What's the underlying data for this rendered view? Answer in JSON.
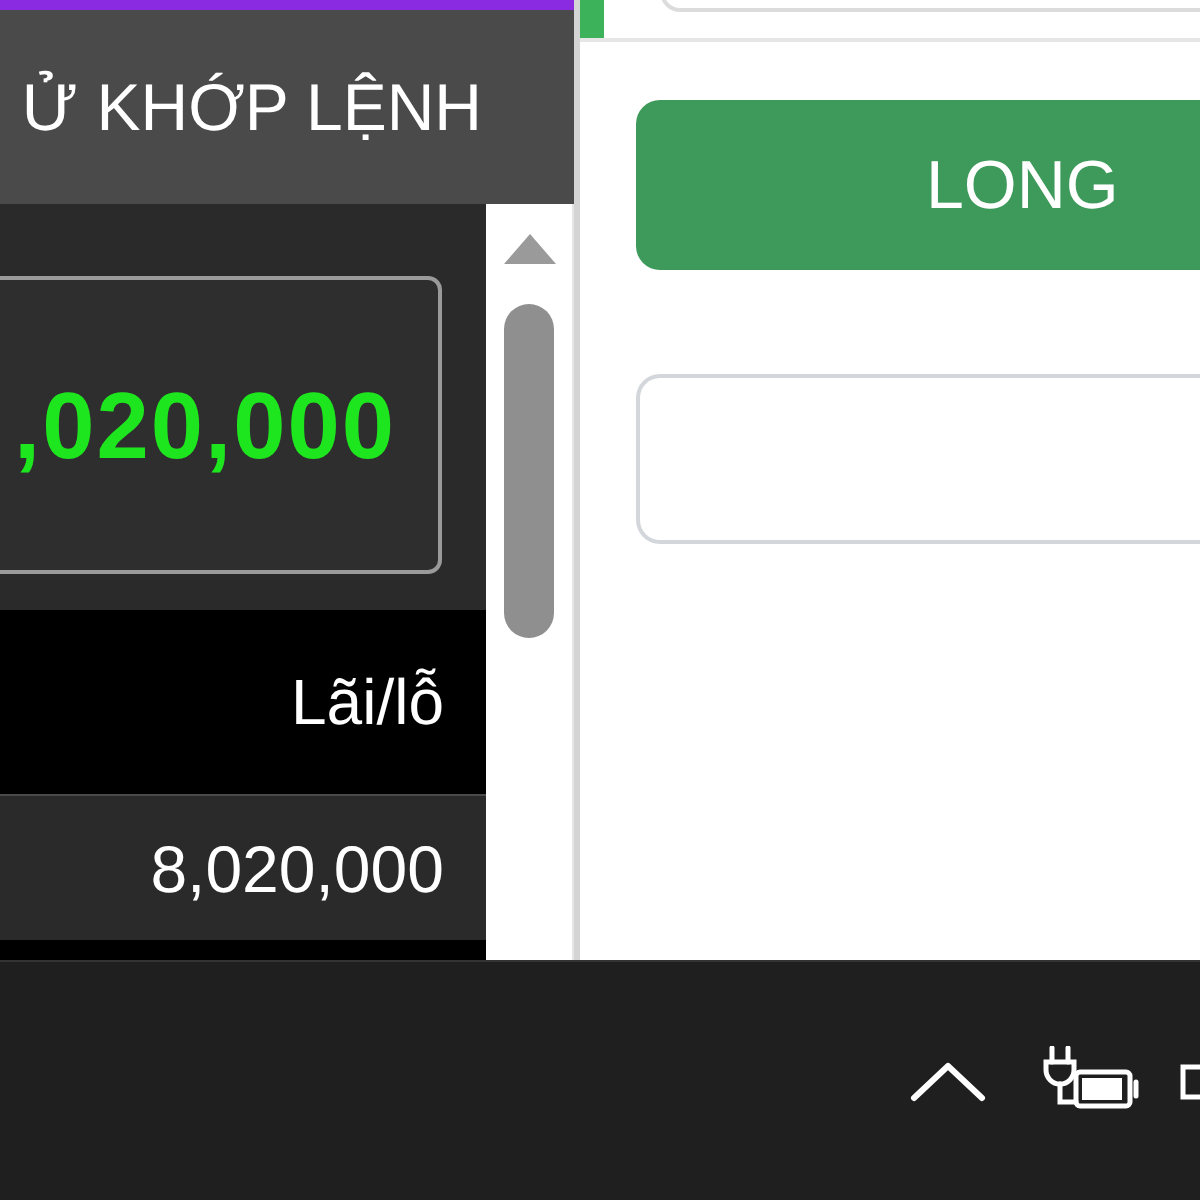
{
  "order_history_panel": {
    "title": "Ử KHỚP LỆNH",
    "summary_value": ",020,000",
    "table": {
      "columns": [
        "Lãi/lỗ"
      ],
      "rows": [
        [
          "8,020,000"
        ]
      ]
    }
  },
  "order_panel": {
    "submit_button": "LONG"
  }
}
